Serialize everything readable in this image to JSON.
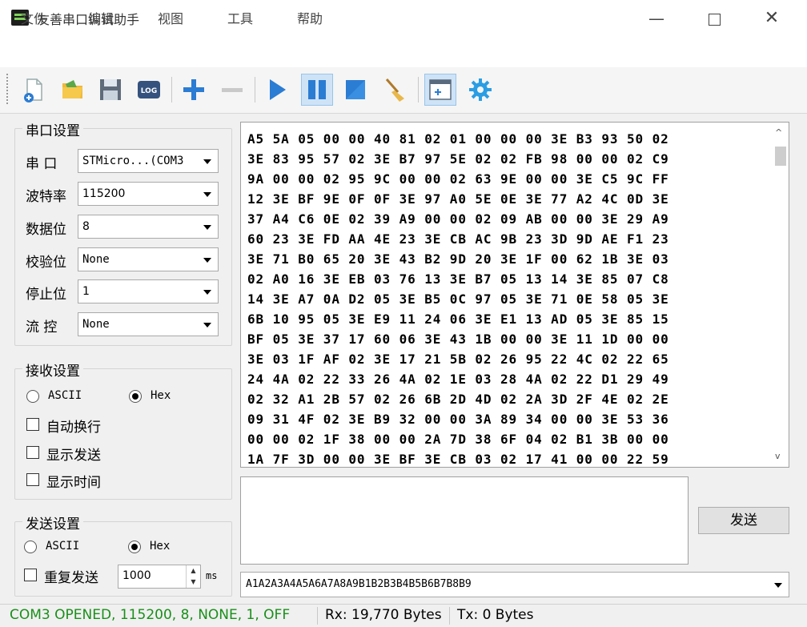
{
  "window": {
    "title": "友善串口调试助手",
    "min_glyph": "—",
    "close_glyph": "✕"
  },
  "menu": [
    "文件",
    "编辑",
    "视图",
    "工具",
    "帮助"
  ],
  "toolbar": {
    "icons": [
      "new-file-icon",
      "open-folder-icon",
      "save-icon",
      "log-icon",
      "add-icon",
      "remove-icon",
      "play-icon",
      "pause-icon",
      "stop-icon",
      "broom-icon",
      "new-window-icon",
      "settings-gear-icon"
    ],
    "log_text": "LOG",
    "accent": "#2b7cd3"
  },
  "port_settings": {
    "title": "串口设置",
    "port_label": "串 口",
    "port_value": "STMicro...(COM3",
    "baud_label": "波特率",
    "baud_value": "115200",
    "databits_label": "数据位",
    "databits_value": "8",
    "parity_label": "校验位",
    "parity_value": "None",
    "stopbits_label": "停止位",
    "stopbits_value": "1",
    "flow_label": "流 控",
    "flow_value": "None"
  },
  "receive_settings": {
    "title": "接收设置",
    "ascii_label": "ASCII",
    "hex_label": "Hex",
    "mode_selected": "Hex",
    "auto_wrap_label": "自动换行",
    "show_send_label": "显示发送",
    "show_time_label": "显示时间"
  },
  "send_settings": {
    "title": "发送设置",
    "ascii_label": "ASCII",
    "hex_label": "Hex",
    "mode_selected": "Hex",
    "repeat_label": "重复发送",
    "interval_value": "1000",
    "interval_unit": "ms"
  },
  "receive_data": [
    "A5 5A 05 00 00 40 81 02 01 00 00 00 3E B3 93 50 02",
    "3E 83 95 57 02 3E B7 97 5E 02 02 FB 98 00 00 02 C9",
    "9A 00 00 02 95 9C 00 00 02 63 9E 00 00 3E C5 9C FF",
    "12 3E BF 9E 0F 0F 3E 97 A0 5E 0E 3E 77 A2 4C 0D 3E",
    "37 A4 C6 0E 02 39 A9 00 00 02 09 AB 00 00 3E 29 A9",
    "60 23 3E FD AA 4E 23 3E CB AC 9B 23 3D 9D AE F1 23",
    "3E 71 B0 65 20 3E 43 B2 9D 20 3E 1F 00 62 1B 3E 03",
    "02 A0 16 3E EB 03 76 13 3E B7 05 13 14 3E 85 07 C8",
    "14 3E A7 0A D2 05 3E B5 0C 97 05 3E 71 0E 58 05 3E",
    "6B 10 95 05 3E E9 11 24 06 3E E1 13 AD 05 3E 85 15",
    "BF 05 3E 37 17 60 06 3E 43 1B 00 00 3E 11 1D 00 00",
    "3E 03 1F AF 02 3E 17 21 5B 02 26 95 22 4C 02 22 65",
    "24 4A 02 22 33 26 4A 02 1E 03 28 4A 02 22 D1 29 49",
    "02 32 A1 2B 57 02 26 6B 2D 4D 02 2A 3D 2F 4E 02 2E",
    "09 31 4F 02 3E B9 32 00 00 3A 89 34 00 00 3E 53 36",
    "00 00 02 1F 38 00 00 2A 7D 38 6F 04 02 B1 3B 00 00",
    "1A 7F 3D 00 00 3E BF 3E CB 03 02 17 41 00 00 22 59"
  ],
  "send": {
    "button_label": "发送",
    "history_value": "A1A2A3A4A5A6A7A8A9B1B2B3B4B5B6B7B8B9"
  },
  "status": {
    "connection": "COM3 OPENED, 115200, 8, NONE, 1, OFF",
    "connection_color": "#1a8f1a",
    "rx": "Rx: 19,770 Bytes",
    "tx": "Tx: 0 Bytes"
  }
}
